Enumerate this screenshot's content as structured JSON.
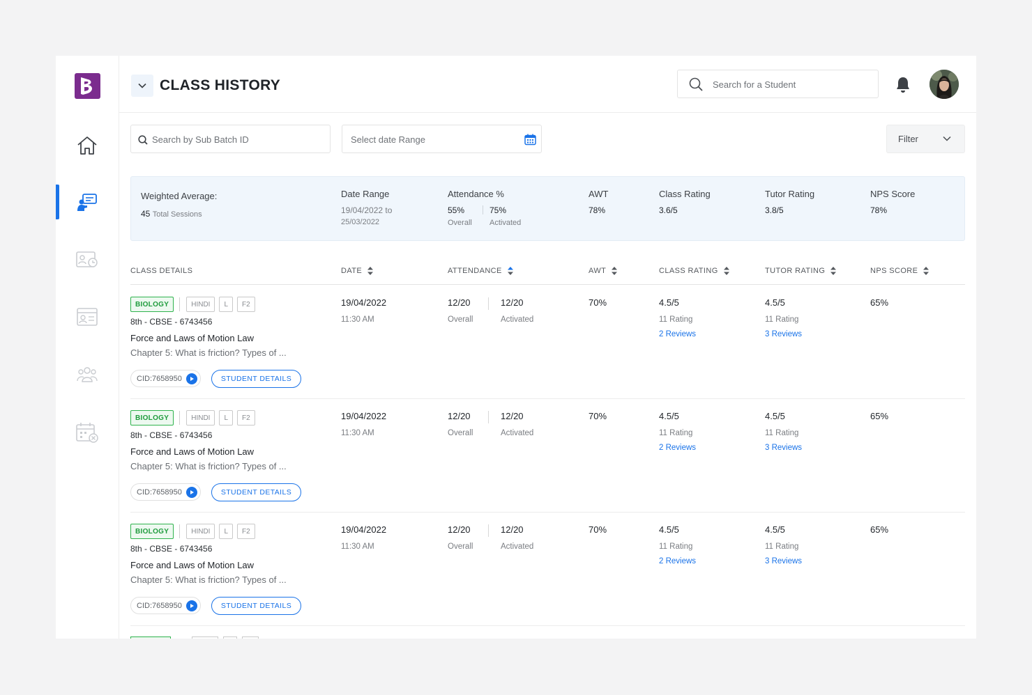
{
  "header": {
    "title": "CLASS HISTORY",
    "student_search_placeholder": "Search for a Student"
  },
  "filters": {
    "sub_batch_placeholder": "Search by Sub Batch ID",
    "date_range_placeholder": "Select date Range",
    "filter_label": "Filter"
  },
  "summary": {
    "title": "Weighted Average:",
    "sessions_count": "45",
    "sessions_label": "Total Sessions",
    "date_range_label": "Date Range",
    "date_range_line1": "19/04/2022 to",
    "date_range_line2": "25/03/2022",
    "attendance_label": "Attendance %",
    "attendance_overall_value": "55%",
    "attendance_overall_label": "Overall",
    "attendance_activated_value": "75%",
    "attendance_activated_label": "Activated",
    "awt_label": "AWT",
    "awt_value": "78%",
    "class_rating_label": "Class Rating",
    "class_rating_value": "3.6/5",
    "tutor_rating_label": "Tutor Rating",
    "tutor_rating_value": "3.8/5",
    "nps_label": "NPS Score",
    "nps_value": "78%"
  },
  "table": {
    "columns": [
      "CLASS DETAILS",
      "DATE",
      "ATTENDANCE",
      "AWT",
      "CLASS RATING",
      "TUTOR RATING",
      "NPS SCORE"
    ],
    "rows": [
      {
        "subject": "BIOLOGY",
        "language": "HINDI",
        "level": "L",
        "format": "F2",
        "batch": "8th - CBSE - 6743456",
        "topic": "Force and Laws of Motion Law",
        "chapter": "Chapter 5: What is friction? Types of ...",
        "cid": "CID:7658950",
        "student_details": "STUDENT DETAILS",
        "date": "19/04/2022",
        "time": "11:30 AM",
        "att_overall": "12/20",
        "att_overall_label": "Overall",
        "att_activated": "12/20",
        "att_activated_label": "Activated",
        "awt": "70%",
        "class_rating": "4.5/5",
        "class_rating_count": "11 Rating",
        "class_reviews": "2 Reviews",
        "tutor_rating": "4.5/5",
        "tutor_rating_count": "11 Rating",
        "tutor_reviews": "3 Reviews",
        "nps": "65%"
      },
      {
        "subject": "BIOLOGY",
        "language": "HINDI",
        "level": "L",
        "format": "F2",
        "batch": "8th - CBSE - 6743456",
        "topic": "Force and Laws of Motion Law",
        "chapter": "Chapter 5: What is friction? Types of ...",
        "cid": "CID:7658950",
        "student_details": "STUDENT DETAILS",
        "date": "19/04/2022",
        "time": "11:30 AM",
        "att_overall": "12/20",
        "att_overall_label": "Overall",
        "att_activated": "12/20",
        "att_activated_label": "Activated",
        "awt": "70%",
        "class_rating": "4.5/5",
        "class_rating_count": "11 Rating",
        "class_reviews": "2 Reviews",
        "tutor_rating": "4.5/5",
        "tutor_rating_count": "11 Rating",
        "tutor_reviews": "3 Reviews",
        "nps": "65%"
      },
      {
        "subject": "BIOLOGY",
        "language": "HINDI",
        "level": "L",
        "format": "F2",
        "batch": "8th - CBSE - 6743456",
        "topic": "Force and Laws of Motion Law",
        "chapter": "Chapter 5: What is friction? Types of ...",
        "cid": "CID:7658950",
        "student_details": "STUDENT DETAILS",
        "date": "19/04/2022",
        "time": "11:30 AM",
        "att_overall": "12/20",
        "att_overall_label": "Overall",
        "att_activated": "12/20",
        "att_activated_label": "Activated",
        "awt": "70%",
        "class_rating": "4.5/5",
        "class_rating_count": "11 Rating",
        "class_reviews": "2 Reviews",
        "tutor_rating": "4.5/5",
        "tutor_rating_count": "11 Rating",
        "tutor_reviews": "3 Reviews",
        "nps": "65%"
      }
    ]
  },
  "icons": {
    "logo": "byjus-logo",
    "nav": [
      "home-icon",
      "class-history-icon",
      "schedule-icon",
      "id-card-icon",
      "students-icon",
      "calendar-icon"
    ]
  },
  "colors": {
    "accent": "#1a73e8",
    "brand": "#7b2c8e",
    "subject_tag": "#2eb24c",
    "summary_bg": "#f0f6fc"
  }
}
